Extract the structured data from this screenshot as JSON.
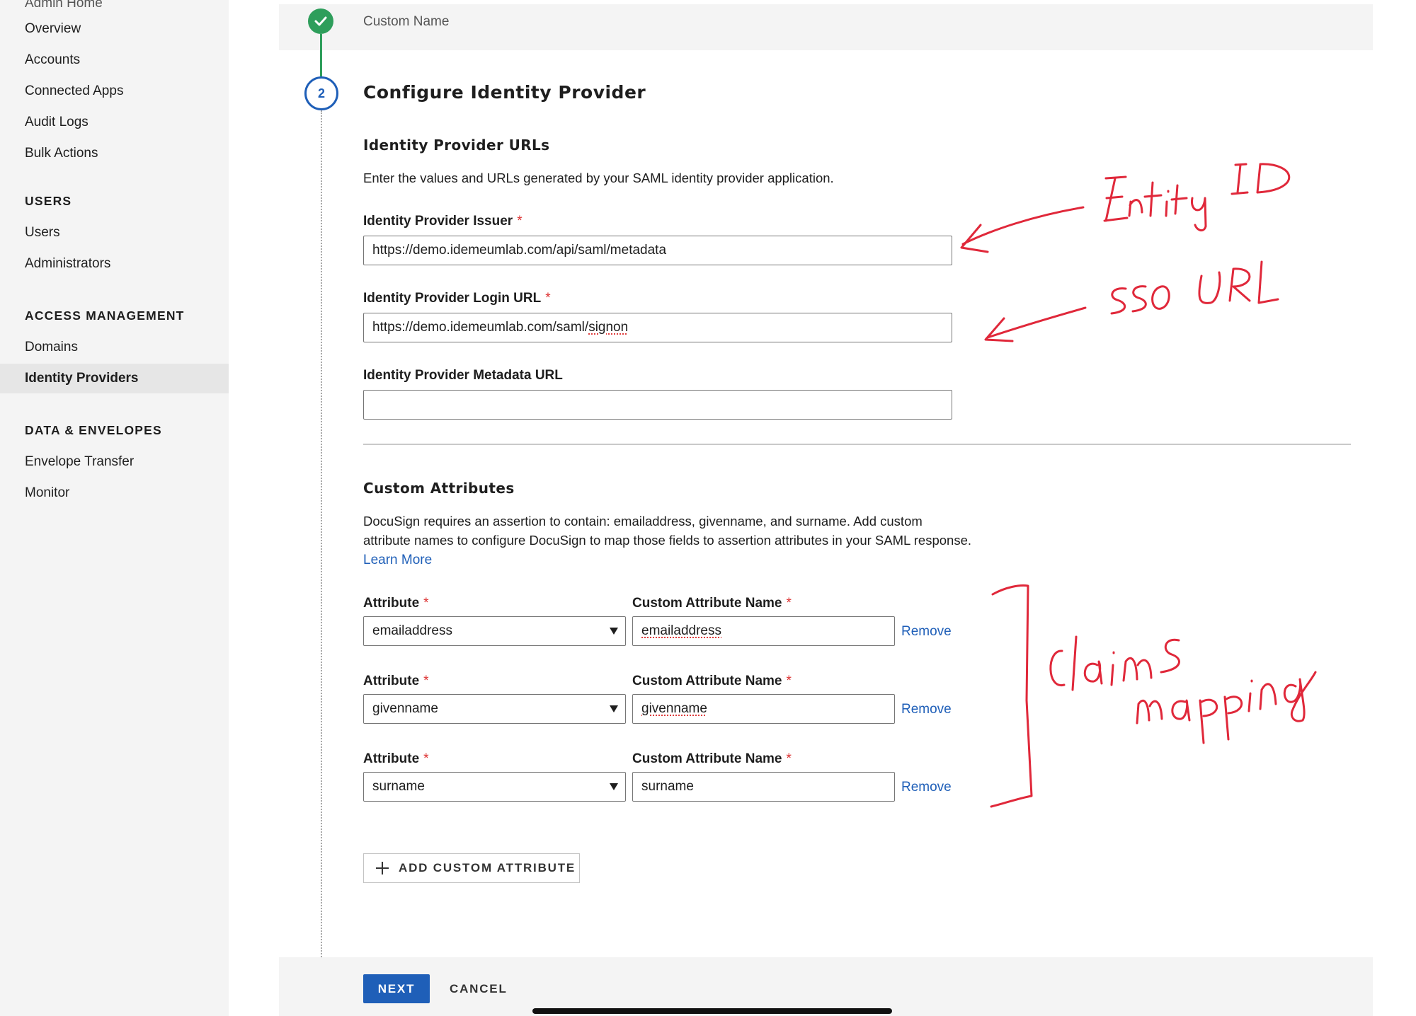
{
  "sidebar": {
    "top_partial": "Admin Home",
    "items_a": [
      "Overview",
      "Accounts",
      "Connected Apps",
      "Audit Logs",
      "Bulk Actions"
    ],
    "section_users": "USERS",
    "items_users": [
      "Users",
      "Administrators"
    ],
    "section_access": "ACCESS MANAGEMENT",
    "items_access": [
      "Domains",
      "Identity Providers"
    ],
    "section_data": "DATA & ENVELOPES",
    "items_data": [
      "Envelope Transfer",
      "Monitor"
    ]
  },
  "stepper": {
    "step1_title": "Custom Name",
    "step2_number": "2",
    "step2_title": "Configure Identity Provider"
  },
  "urls_section": {
    "title": "Identity Provider URLs",
    "description": "Enter the values and URLs generated by your SAML identity provider application.",
    "issuer_label": "Identity Provider Issuer",
    "issuer_value": "https://demo.idemeumlab.com/api/saml/metadata",
    "login_label": "Identity Provider Login URL",
    "login_value_prefix": "https://demo.idemeumlab.com/saml/",
    "login_value_suffix": "signon",
    "metadata_label": "Identity Provider Metadata URL",
    "metadata_value": "",
    "required_mark": "*"
  },
  "attributes_section": {
    "title": "Custom Attributes",
    "description": "DocuSign requires an assertion to contain: emailaddress, givenname, and surname. Add custom attribute names to configure DocuSign to map those fields to assertion attributes in your SAML response.",
    "learn_more": "Learn More",
    "attribute_label": "Attribute",
    "custom_name_label": "Custom Attribute Name",
    "remove_label": "Remove",
    "rows": [
      {
        "attribute": "emailaddress",
        "custom_name": "emailaddress"
      },
      {
        "attribute": "givenname",
        "custom_name": "givenname"
      },
      {
        "attribute": "surname",
        "custom_name": "surname"
      }
    ],
    "add_button": "ADD CUSTOM ATTRIBUTE"
  },
  "footer": {
    "next": "NEXT",
    "cancel": "CANCEL"
  },
  "colors": {
    "primary": "#1f5fb8",
    "success": "#2e9e5b",
    "annotation": "#e0283a"
  }
}
